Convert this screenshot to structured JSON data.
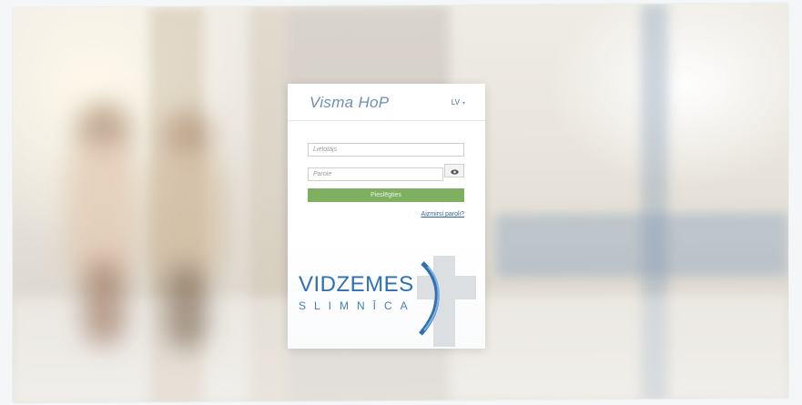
{
  "header": {
    "app_title": "Visma HoP",
    "language": "LV"
  },
  "login_form": {
    "username_placeholder": "Lietotājs",
    "password_placeholder": "Parole",
    "show_password_icon": "eye-icon",
    "login_label": "Pieslēgties",
    "forgot_password_label": "Aizmirsi paroli?"
  },
  "logo": {
    "name_line": "VIDZEMES",
    "sub_line": "SLIMNĪCA"
  },
  "colors": {
    "accent_blue": "#6d8fb5",
    "login_green": "#7fb062",
    "link_blue": "#2e63a8",
    "logo_blue": "#2f6fb3"
  }
}
